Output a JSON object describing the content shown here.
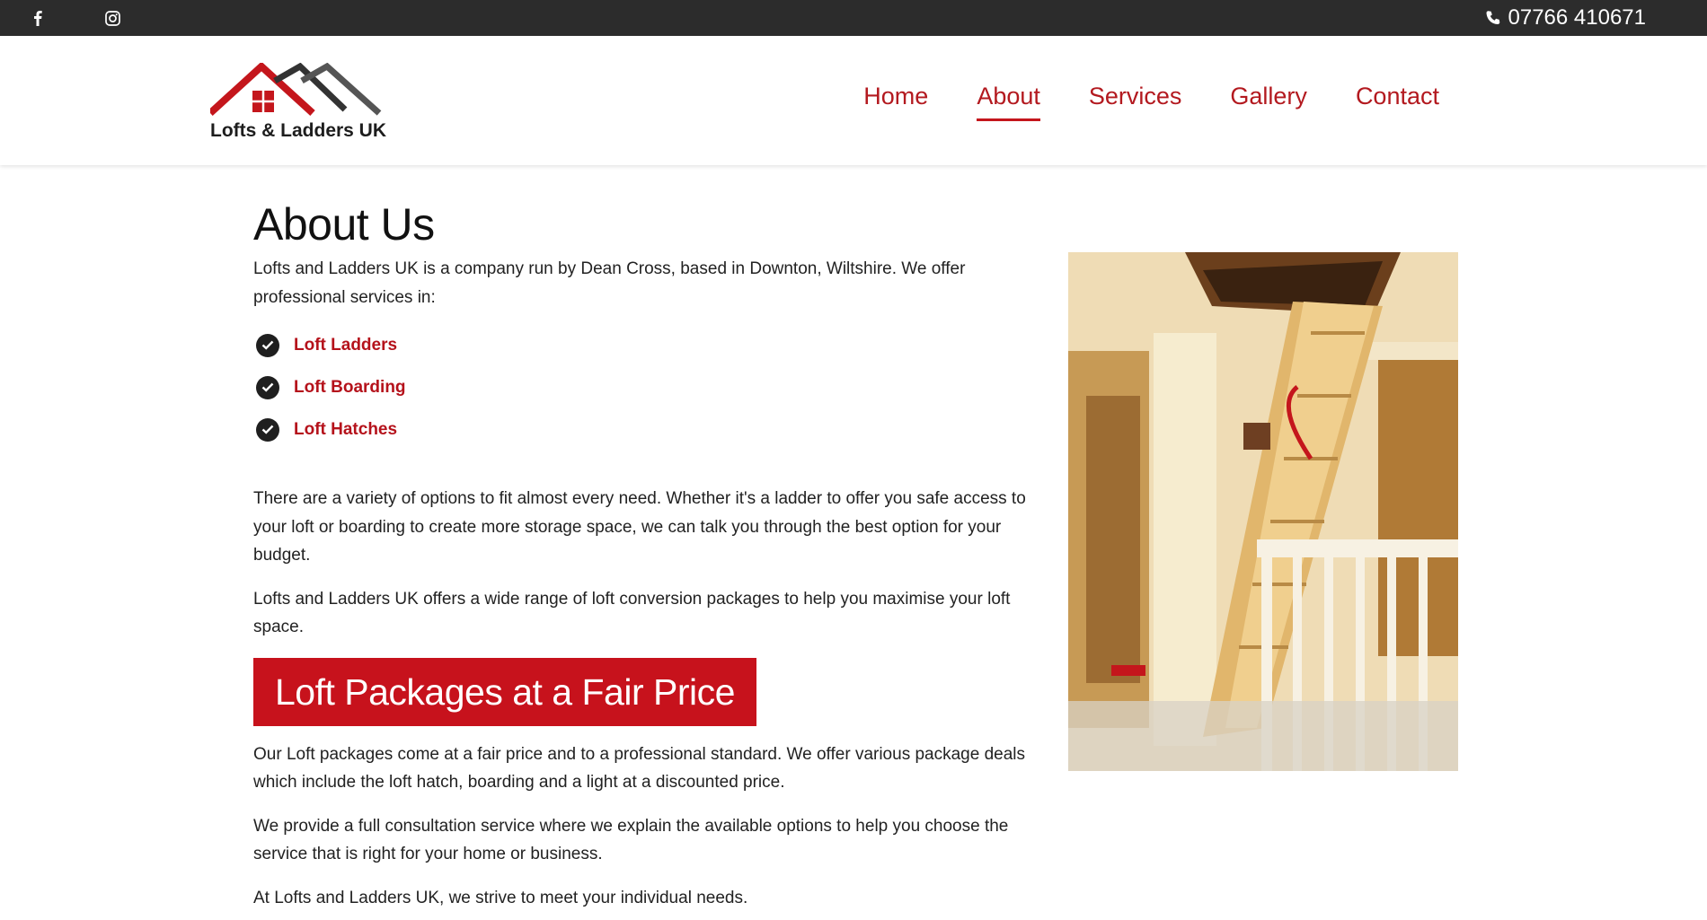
{
  "topbar": {
    "social_icons": [
      "facebook-icon",
      "instagram-icon"
    ],
    "phone_icon": "phone-icon",
    "phone_number": "07766 410671"
  },
  "header": {
    "logo_text": "Lofts & Ladders UK",
    "nav": [
      {
        "label": "Home",
        "active": false
      },
      {
        "label": "About",
        "active": true
      },
      {
        "label": "Services",
        "active": false
      },
      {
        "label": "Gallery",
        "active": false
      },
      {
        "label": "Contact",
        "active": false
      }
    ]
  },
  "main": {
    "title": "About Us",
    "intro": "Lofts and Ladders UK is a company run by Dean Cross, based in Downton, Wiltshire. We offer professional services in:",
    "services": [
      "Loft Ladders",
      "Loft Boarding",
      "Loft Hatches"
    ],
    "paragraph1": "There are a variety of options to fit almost every need. Whether it's a ladder to offer you safe access to your loft or boarding to create more storage space, we can talk you through the best option for your budget.",
    "paragraph2": "Lofts and Ladders UK offers a wide range of loft conversion packages to help you maximise your loft space.",
    "banner": "Loft Packages at a Fair Price",
    "paragraph3": "Our Loft packages come at a fair price and to a professional standard. We offer various package deals which include the loft hatch, boarding and a light at a discounted price.",
    "paragraph4": "We provide a full consultation service where we explain the available options to help you choose the service that is right for your home or business.",
    "paragraph5": "At Lofts and Ladders UK, we strive to meet your individual needs."
  },
  "colors": {
    "brand_red": "#c4161c",
    "nav_red": "#b3191f",
    "topbar": "#2c2c2c"
  }
}
